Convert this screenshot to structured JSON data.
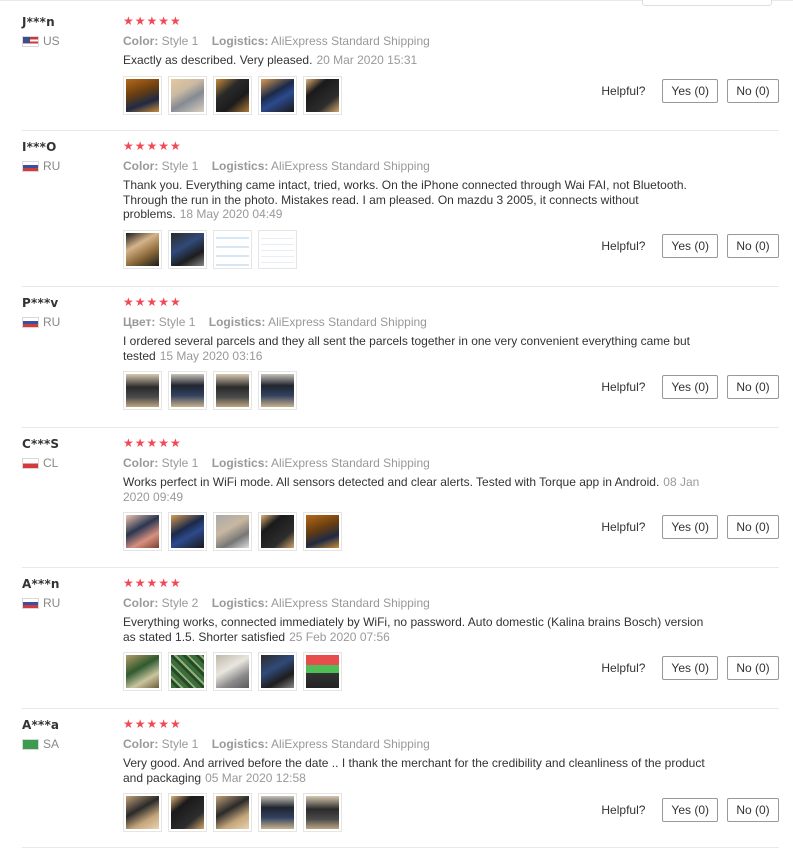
{
  "helpful_label": "Helpful?",
  "reviews": [
    {
      "user": "J***n",
      "country": "US",
      "stars": "★★★★★",
      "color_label": "Color:",
      "color": "Style 1",
      "logistics_label": "Logistics:",
      "logistics": "AliExpress Standard Shipping",
      "text": "Exactly as described. Very pleased.",
      "date": "20 Mar 2020 15:31",
      "yes": "Yes (0)",
      "no": "No (0)",
      "photos": [
        "p-amber",
        "p-grey",
        "p-dark",
        "p-blue",
        "p-black"
      ]
    },
    {
      "user": "I***O",
      "country": "RU",
      "stars": "★★★★★",
      "color_label": "Color:",
      "color": "Style 1",
      "logistics_label": "Logistics:",
      "logistics": "AliExpress Standard Shipping",
      "text": "Thank you. Everything came intact, tried, works. On the iPhone connected through Wai FAI, not Bluetooth. Through the run in the photo. Mistakes read. I am pleased. On mazdu 3 2005, it connects without problems.",
      "date": "18 May 2020 04:49",
      "yes": "Yes (0)",
      "no": "No (0)",
      "photos": [
        "p-hand",
        "p-phone",
        "p-screen",
        "p-screen2"
      ]
    },
    {
      "user": "P***v",
      "country": "RU",
      "stars": "★★★★★",
      "color_label": "Цвет:",
      "color": "Style 1",
      "logistics_label": "Logistics:",
      "logistics": "AliExpress Standard Shipping",
      "text": "I ordered several parcels and they all sent the parcels together in one very convenient everything came but tested",
      "date": "15 May 2020 03:16",
      "yes": "Yes (0)",
      "no": "No (0)",
      "photos": [
        "p-car2",
        "p-car",
        "p-car2",
        "p-car"
      ]
    },
    {
      "user": "C***S",
      "country": "CL",
      "stars": "★★★★★",
      "color_label": "Color:",
      "color": "Style 1",
      "logistics_label": "Logistics:",
      "logistics": "AliExpress Standard Shipping",
      "text": "Works perfect in WiFi mode. All sensors detected and clear alerts. Tested with Torque app in Android.",
      "date": "08 Jan 2020 09:49",
      "yes": "Yes (0)",
      "no": "No (0)",
      "photos": [
        "p-pink",
        "p-blue",
        "p-grey2",
        "p-black",
        "p-amber"
      ]
    },
    {
      "user": "A***n",
      "country": "RU",
      "stars": "★★★★★",
      "color_label": "Color:",
      "color": "Style 2",
      "logistics_label": "Logistics:",
      "logistics": "AliExpress Standard Shipping",
      "text": "Everything works, connected immediately by WiFi, no password. Auto domestic (Kalina brains Bosch) version as stated 1.5. Shorter satisfied",
      "date": "25 Feb 2020 07:56",
      "yes": "Yes (0)",
      "no": "No (0)",
      "photos": [
        "p-green",
        "p-chip",
        "p-white",
        "p-phone",
        "p-color"
      ]
    },
    {
      "user": "A***a",
      "country": "SA",
      "stars": "★★★★★",
      "color_label": "Color:",
      "color": "Style 1",
      "logistics_label": "Logistics:",
      "logistics": "AliExpress Standard Shipping",
      "text": "Very good. And arrived before the date .. I thank the merchant for the credibility and cleanliness of the product and packaging",
      "date": "05 Mar 2020 12:58",
      "yes": "Yes (0)",
      "no": "No (0)",
      "photos": [
        "p-mix",
        "p-black",
        "p-mix",
        "p-car",
        "p-car2"
      ]
    }
  ]
}
